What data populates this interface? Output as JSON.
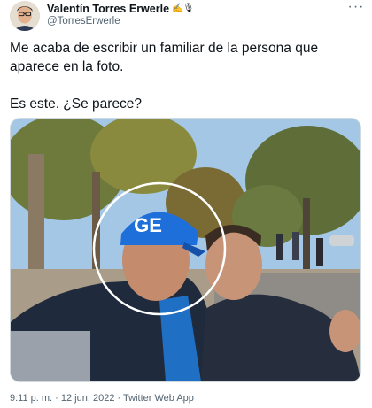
{
  "author": {
    "display_name": "Valentín Torres Erwerle",
    "name_emojis": "✍️🎙",
    "handle": "@TorresErwerle"
  },
  "tweet": {
    "line1": "Me acaba de escribir un familiar de la persona que aparece en la foto.",
    "line2": "Es este. ¿Se parece?"
  },
  "photo": {
    "cap_text": "GE"
  },
  "meta": {
    "time": "9:11 p. m.",
    "separator1": " · ",
    "date": "12 jun. 2022",
    "separator2": " · ",
    "source": "Twitter Web App"
  },
  "colors": {
    "text": "#0f1419",
    "secondary": "#536471",
    "cap_blue": "#1e6fd9",
    "highlight_circle": "#ffffff"
  },
  "icons": {
    "more": "more-dots-icon"
  }
}
